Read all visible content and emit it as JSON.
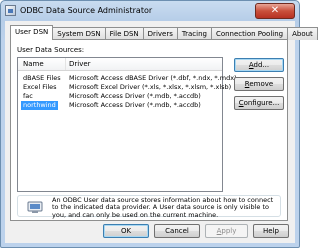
{
  "window": {
    "title": "ODBC Data Source Administrator",
    "close_label": "✕"
  },
  "tabs": [
    {
      "label": "User DSN",
      "active": true
    },
    {
      "label": "System DSN",
      "active": false
    },
    {
      "label": "File DSN",
      "active": false
    },
    {
      "label": "Drivers",
      "active": false
    },
    {
      "label": "Tracing",
      "active": false
    },
    {
      "label": "Connection Pooling",
      "active": false
    },
    {
      "label": "About",
      "active": false
    }
  ],
  "panel": {
    "sources_label": "User Data Sources:",
    "columns": {
      "name": "Name",
      "driver": "Driver"
    },
    "rows": [
      {
        "name": "dBASE Files",
        "driver": "Microsoft Access dBASE Driver (*.dbf, *.ndx, *.mdx)",
        "selected": false
      },
      {
        "name": "Excel Files",
        "driver": "Microsoft Excel Driver (*.xls, *.xlsx, *.xlsm, *.xlsb)",
        "selected": false
      },
      {
        "name": "fac",
        "driver": "Microsoft Access Driver (*.mdb, *.accdb)",
        "selected": false
      },
      {
        "name": "northwind",
        "driver": "Microsoft Access Driver (*.mdb, *.accdb)",
        "selected": true
      }
    ],
    "buttons": {
      "add": {
        "pre": "",
        "key": "A",
        "post": "dd..."
      },
      "remove": {
        "pre": "",
        "key": "R",
        "post": "emove"
      },
      "configure": {
        "pre": "",
        "key": "C",
        "post": "onfigure..."
      }
    },
    "info_text": "An ODBC User data source stores information about how to connect to the indicated data provider.  A User data source is only visible to you, and can only be used on the current machine."
  },
  "footer": {
    "ok": "OK",
    "cancel": "Cancel",
    "apply": {
      "pre": "",
      "key": "A",
      "post": "pply"
    },
    "help": "Help"
  },
  "colors": {
    "selection": "#3399ff",
    "close_button": "#c9503c"
  },
  "icons": [
    "app-icon",
    "close-icon",
    "info-icon"
  ]
}
